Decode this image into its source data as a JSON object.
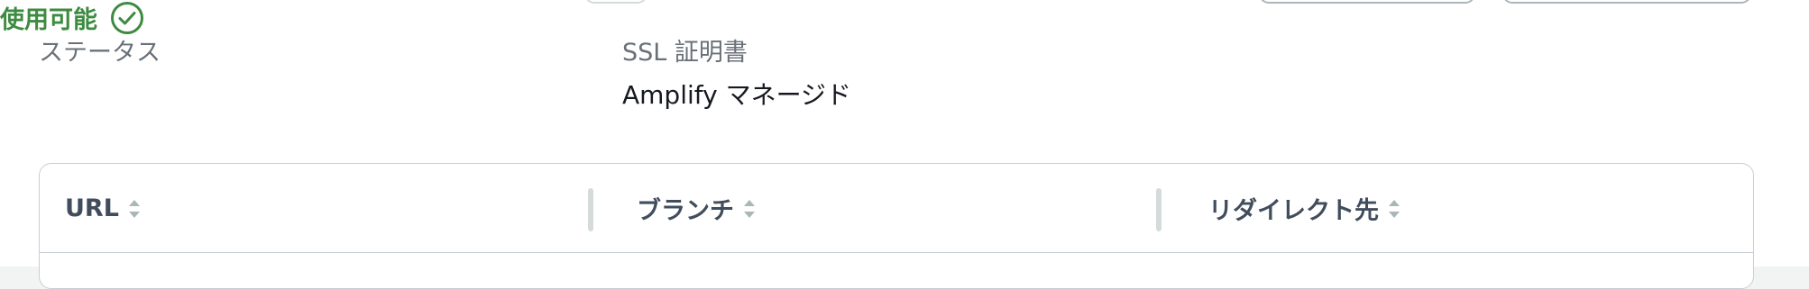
{
  "fields": {
    "status": {
      "label": "ステータス",
      "value": "使用可能",
      "value_color": "#3d8b40",
      "icon": "check-circle-icon"
    },
    "ssl": {
      "label": "SSL 証明書",
      "value": "Amplify マネージド"
    }
  },
  "table": {
    "columns": [
      {
        "label": "URL",
        "sort_icon": "sort-icon"
      },
      {
        "label": "ブランチ",
        "sort_icon": "sort-icon"
      },
      {
        "label": "リダイレクト先",
        "sort_icon": "sort-icon"
      }
    ]
  },
  "colors": {
    "status_success": "#3d8b40",
    "header_text": "#414d5c",
    "label_text": "#687078",
    "border": "#c8ced3"
  }
}
